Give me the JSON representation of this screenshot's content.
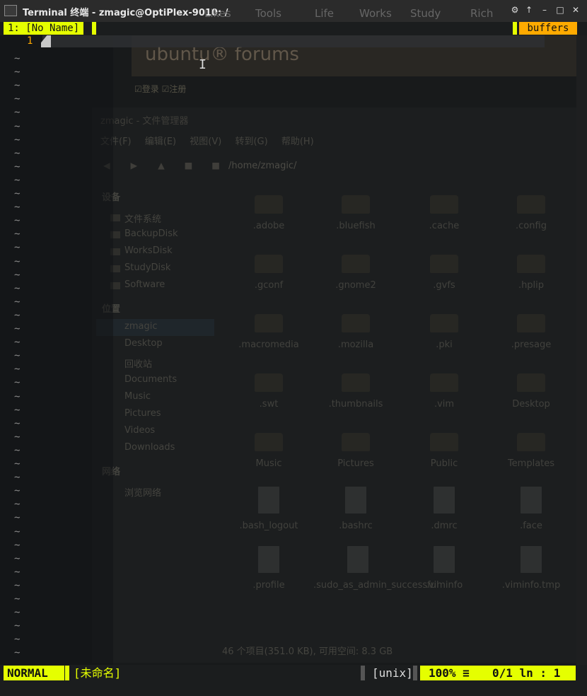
{
  "window": {
    "title": "Terminal 终端 - zmagic@OptiPlex-9010: /",
    "bookmarks": [
      "Likes",
      "Tools",
      "Life",
      "Works",
      "Study",
      "Rich"
    ]
  },
  "vim": {
    "tab_label": "1: [No Name]",
    "buffers_label": "buffers",
    "line_number": "1",
    "tilde": "~",
    "mode": "NORMAL",
    "filename": "[未命名]",
    "format": "[unix]",
    "percent": "100% ≡",
    "position": "0/1 ln :  1"
  },
  "background": {
    "forum_logo": "ubuntu® forums",
    "forum_links": [
      "☑登录",
      "☑注册"
    ],
    "file_manager": {
      "title": "zmagic - 文件管理器",
      "menu": [
        "文件(F)",
        "编辑(E)",
        "视图(V)",
        "转到(G)",
        "帮助(H)"
      ],
      "path": "/home/zmagic/",
      "devices_heading": "设备",
      "devices": [
        "文件系统",
        "BackupDisk",
        "WorksDisk",
        "StudyDisk",
        "Software"
      ],
      "places_heading": "位置",
      "places": [
        "zmagic",
        "Desktop",
        "回收站",
        "Documents",
        "Music",
        "Pictures",
        "Videos",
        "Downloads"
      ],
      "network_heading": "网络",
      "network": [
        "浏览网络"
      ],
      "files": [
        ".adobe",
        ".bluefish",
        ".cache",
        ".config",
        ".gconf",
        ".gnome2",
        ".gvfs",
        ".hplip",
        ".macromedia",
        ".mozilla",
        ".pki",
        ".presage",
        ".swt",
        ".thumbnails",
        ".vim",
        "Desktop",
        "Music",
        "Pictures",
        "Public",
        "Templates",
        ".bash_logout",
        ".bashrc",
        ".dmrc",
        ".face",
        ".profile",
        ".sudo_as_admin_successful",
        ".viminfo",
        ".viminfo.tmp"
      ],
      "status": "46 个项目(351.0 KB), 可用空间: 8.3 GB"
    }
  },
  "colors": {
    "accent_yellow": "#e5ff00",
    "accent_orange": "#ffaa00",
    "terminal_bg": "#1b1d1e"
  }
}
